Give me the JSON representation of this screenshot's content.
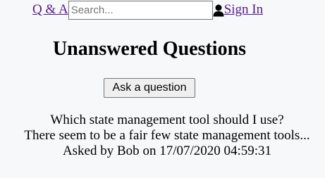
{
  "header": {
    "brand": "Q & A",
    "search_placeholder": "Search...",
    "search_value": "",
    "sign_in_label": "Sign In",
    "sign_in_icon": "user-icon"
  },
  "main": {
    "title": "Unanswered Questions",
    "ask_button_label": "Ask a question",
    "questions": [
      {
        "title": "Which state management tool should I use?",
        "content": "There seem to be a fair few state management tools...",
        "asked_by_prefix": "Asked by",
        "user": "Bob",
        "on_word": "on",
        "date": "17/07/2020 04:59:31"
      }
    ]
  },
  "colors": {
    "link": "#551a8b",
    "background": "#f7f8fa"
  }
}
